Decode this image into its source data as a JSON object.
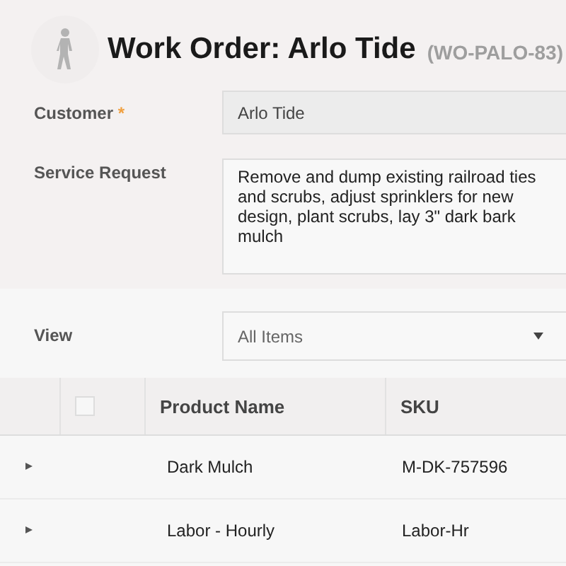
{
  "header": {
    "title": "Work Order: Arlo Tide",
    "code": "(WO-PALO-83)"
  },
  "form": {
    "customer": {
      "label": "Customer",
      "required_mark": "*",
      "value": "Arlo Tide"
    },
    "service_request": {
      "label": "Service Request",
      "value": "Remove and dump existing railroad ties and scrubs, adjust sprinklers for new design, plant scrubs, lay 3\" dark bark mulch"
    },
    "view": {
      "label": "View",
      "value": "All Items"
    }
  },
  "table": {
    "select_all": {
      "checked": false
    },
    "columns": [
      "Product Name",
      "SKU"
    ],
    "rows": [
      {
        "expanded": false,
        "cells": [
          "Dark Mulch",
          "M-DK-757596"
        ]
      },
      {
        "expanded": false,
        "cells": [
          "Labor - Hourly",
          "Labor-Hr"
        ]
      }
    ]
  }
}
